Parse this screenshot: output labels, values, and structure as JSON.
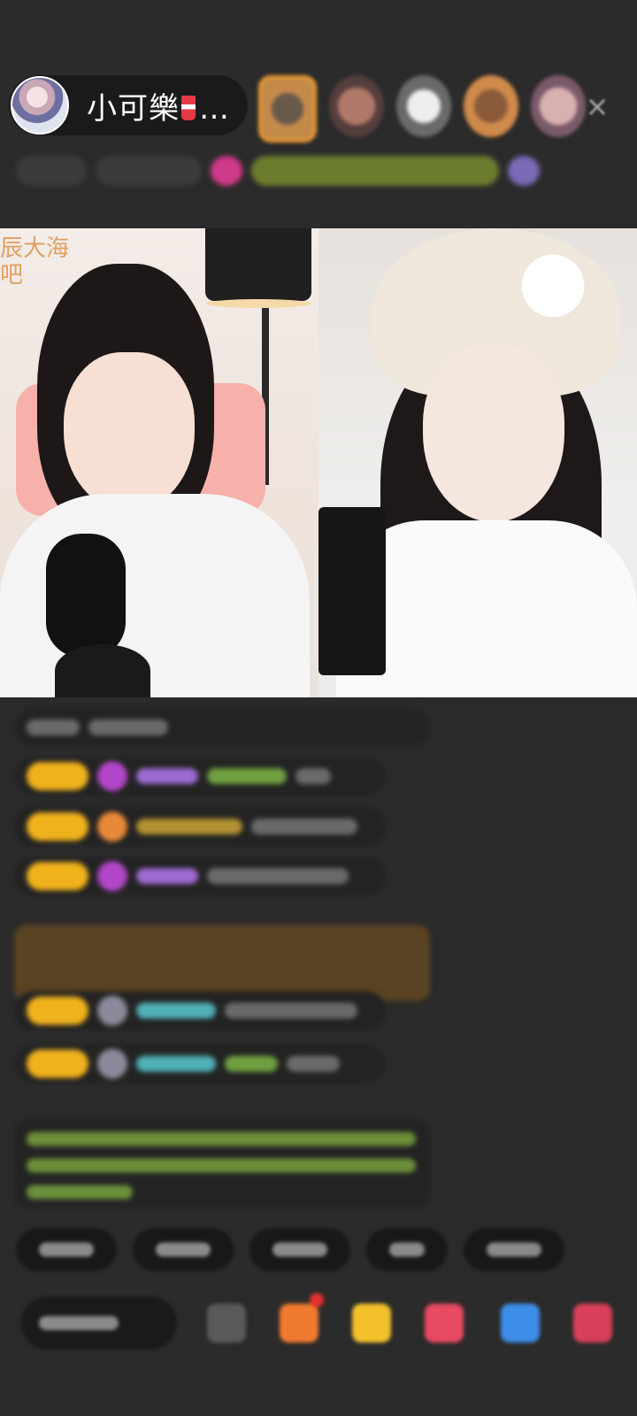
{
  "host": {
    "name": "小可樂",
    "ellipsis": "…",
    "cup_icon": "drink-cup-icon"
  },
  "video": {
    "left_watermark_line1": "辰大海",
    "left_watermark_line2": "吧"
  },
  "close_icon": "×",
  "colors": {
    "background": "#2b2b2b",
    "badge_yellow": "#f0b21c",
    "vip_purple": "#b246c8",
    "system_green": "#6c8f3a"
  }
}
